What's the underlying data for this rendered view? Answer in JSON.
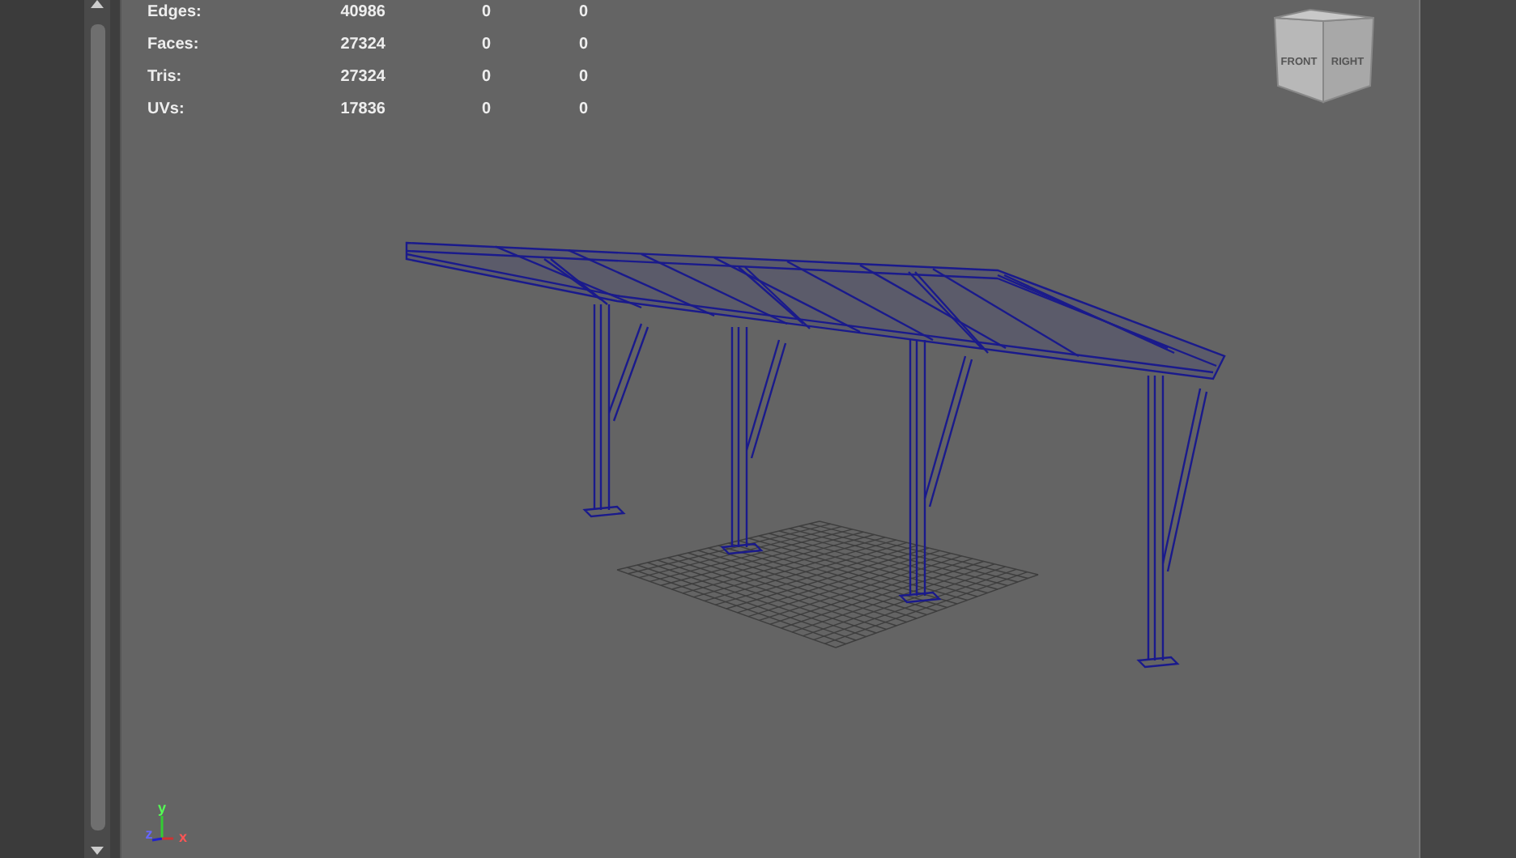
{
  "stats": [
    {
      "label": "Edges:",
      "total": "40986",
      "selected": "0",
      "triangles": "0"
    },
    {
      "label": "Faces:",
      "total": "27324",
      "selected": "0",
      "triangles": "0"
    },
    {
      "label": "Tris:",
      "total": "27324",
      "selected": "0",
      "triangles": "0"
    },
    {
      "label": "UVs:",
      "total": "17836",
      "selected": "0",
      "triangles": "0"
    }
  ],
  "view_cube": {
    "faces": [
      "FRONT",
      "RIGHT"
    ]
  },
  "axis": {
    "labels": [
      "y",
      "z",
      "x"
    ]
  }
}
